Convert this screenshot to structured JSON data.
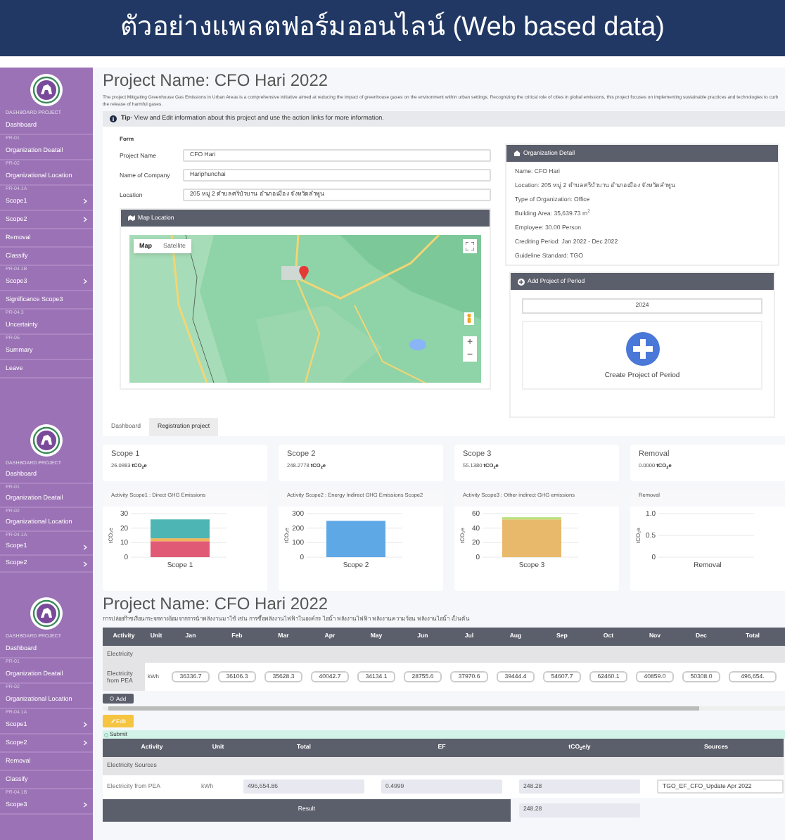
{
  "slide_title": "ตัวอย่างแพลตฟอร์มออนไลน์ (Web based data)",
  "project_panel": {
    "sidebar": {
      "subtitle": "DASHBOARD PROJECT",
      "items": [
        {
          "kind": "link",
          "label": "Dashboard",
          "submenu": false
        },
        {
          "kind": "section",
          "label": "PR-01"
        },
        {
          "kind": "link",
          "label": "Organization Deatail",
          "submenu": false
        },
        {
          "kind": "section",
          "label": "PR-02"
        },
        {
          "kind": "link",
          "label": "Organizational Location",
          "submenu": false
        },
        {
          "kind": "section",
          "label": "PR-04.1A"
        },
        {
          "kind": "link",
          "label": "Scope1",
          "submenu": true
        },
        {
          "kind": "link",
          "label": "Scope2",
          "submenu": true
        },
        {
          "kind": "link",
          "label": "Removal",
          "submenu": false
        },
        {
          "kind": "link",
          "label": "Classify",
          "submenu": false
        },
        {
          "kind": "section",
          "label": "PR-04.1B"
        },
        {
          "kind": "link",
          "label": "Scope3",
          "submenu": true
        },
        {
          "kind": "link",
          "label": "Significance Scope3",
          "submenu": false
        },
        {
          "kind": "section",
          "label": "PR-04.3"
        },
        {
          "kind": "link",
          "label": "Uncertainty",
          "submenu": false
        },
        {
          "kind": "section",
          "label": "PR-05"
        },
        {
          "kind": "link",
          "label": "Summary",
          "submenu": false
        },
        {
          "kind": "link",
          "label": "Leave",
          "submenu": false
        }
      ]
    },
    "title": "Project Name: CFO Hari 2022",
    "description": "The project Mitigating Greenhouse Gas Emissions in Urban Areas is a comprehensive initiative aimed at reducing the impact of greenhouse gases on the environment within urban settings. Recognizing the critical role of cities in global emissions, this project focuses on implementing sustainable practices and technologies to curb the release of harmful gases.",
    "tip": "**Tip**- View and Edit information about this project and use the action links for more information.",
    "form": {
      "heading": "Form",
      "fields": [
        {
          "label": "Project Name",
          "value": "CFO Hari"
        },
        {
          "label": "Name of Company",
          "value": "Hariphunchai"
        },
        {
          "label": "Location",
          "value": "205 หมู่ 2 ตำบลศรีบัวบาน อำเภอเมือง จังหวัดลำพูน"
        }
      ]
    },
    "map": {
      "header": "Map Location",
      "map_types": [
        {
          "label": "Map",
          "selected": true
        },
        {
          "label": "Satellite",
          "selected": false
        }
      ],
      "zoom_in": "+",
      "zoom_out": "−"
    },
    "organization_detail": {
      "header": "Organization Detail",
      "lines": [
        "Name: CFO Hari",
        "Location: 205 หมู่ 2 ตำบลศรีบัวบาน อำเภอเมือง จังหวัดลำพูน",
        "Type of Organization: Office",
        "Building Area: 35,639.73 m$^{2}$",
        "Employee: 30.00 Person",
        "Crediting Period: Jan 2022 - Dec 2022",
        "Guideline Standard: TGO"
      ]
    },
    "add_period": {
      "header": "Add Project of Period",
      "year": "2024",
      "create_label": "Create Project of Period"
    },
    "tabs": [
      {
        "label": "Dashboard",
        "selected": true
      },
      {
        "label": "Registration project",
        "selected": false
      }
    ]
  },
  "dashboard_panel": {
    "sidebar": {
      "subtitle": "DASHBOARD PROJECT",
      "items": [
        {
          "kind": "link",
          "label": "Dashboard",
          "submenu": false
        },
        {
          "kind": "section",
          "label": "PR-01"
        },
        {
          "kind": "link",
          "label": "Organization Deatail",
          "submenu": false
        },
        {
          "kind": "section",
          "label": "PR-02"
        },
        {
          "kind": "link",
          "label": "Organizational Location",
          "submenu": false
        },
        {
          "kind": "section",
          "label": "PR-04.1A"
        },
        {
          "kind": "link",
          "label": "Scope1",
          "submenu": true
        },
        {
          "kind": "link",
          "label": "Scope2",
          "submenu": true
        }
      ]
    },
    "stats": [
      {
        "label": "Scope 1",
        "value": "26.0983",
        "unit": "tCO$_{2}$e"
      },
      {
        "label": "Scope 2",
        "value": "248.2778",
        "unit": "tCO$_{2}$e"
      },
      {
        "label": "Scope 3",
        "value": "55.1380",
        "unit": "tCO$_{2}$e"
      },
      {
        "label": "Removal",
        "value": "0.0000",
        "unit": "tCO$_{2}$e"
      }
    ],
    "charts": [
      {
        "title": "Activity Scope1 : Direct GHG Emissions",
        "chart_data": {
          "type": "bar",
          "stacked": true,
          "ylabel": "tCO₂e",
          "categories": [
            "Scope 1"
          ],
          "ylim": [
            0,
            30
          ],
          "yticks": [
            0,
            10,
            20,
            30
          ],
          "series": [
            {
              "color": "#e05a75",
              "values": [
                11
              ]
            },
            {
              "color": "#f0b55a",
              "values": [
                2
              ]
            },
            {
              "color": "#4db6b4",
              "values": [
                13
              ]
            }
          ]
        }
      },
      {
        "title": "Activity Scope2 : Energy Indirect GHG Emissions Scope2",
        "chart_data": {
          "type": "bar",
          "stacked": true,
          "ylabel": "tCO₂e",
          "categories": [
            "Scope 2"
          ],
          "ylim": [
            0,
            300
          ],
          "yticks": [
            0,
            100,
            200,
            300
          ],
          "series": [
            {
              "color": "#5ea8e6",
              "values": [
                250
              ]
            }
          ]
        }
      },
      {
        "title": "Activity Scope3 : Other indirect GHG emissions",
        "chart_data": {
          "type": "bar",
          "stacked": true,
          "ylabel": "tCO₂e",
          "categories": [
            "Scope 3"
          ],
          "ylim": [
            0,
            60
          ],
          "yticks": [
            0,
            20,
            40,
            60
          ],
          "series": [
            {
              "color": "#e8b96a",
              "values": [
                52
              ]
            },
            {
              "color": "#b8e07a",
              "values": [
                3
              ]
            }
          ]
        }
      },
      {
        "title": "Removal",
        "chart_data": {
          "type": "bar",
          "stacked": true,
          "ylabel": "tCO₂e",
          "categories": [
            "Removal"
          ],
          "ylim": [
            0,
            1
          ],
          "yticks": [
            0,
            {
              "value": 0.5,
              "label": "0.5"
            },
            {
              "value": 1,
              "label": "1.0"
            }
          ],
          "series": [
            {
              "color": "#5ea8e6",
              "values": [
                0
              ]
            }
          ]
        }
      }
    ]
  },
  "activity_panel": {
    "sidebar": {
      "subtitle": "DASHBOARD PROJECT",
      "items": [
        {
          "kind": "link",
          "label": "Dashboard",
          "submenu": false
        },
        {
          "kind": "section",
          "label": "PR-01"
        },
        {
          "kind": "link",
          "label": "Organization Deatail",
          "submenu": false
        },
        {
          "kind": "section",
          "label": "PR-02"
        },
        {
          "kind": "link",
          "label": "Organizational Location",
          "submenu": false
        },
        {
          "kind": "section",
          "label": "PR-04.1A"
        },
        {
          "kind": "link",
          "label": "Scope1",
          "submenu": true
        },
        {
          "kind": "link",
          "label": "Scope2",
          "submenu": true
        },
        {
          "kind": "link",
          "label": "Removal",
          "submenu": false
        },
        {
          "kind": "link",
          "label": "Classify",
          "submenu": false
        },
        {
          "kind": "section",
          "label": "PR-04.1B"
        },
        {
          "kind": "link",
          "label": "Scope3",
          "submenu": true
        }
      ]
    },
    "title": "Project Name: CFO Hari 2022",
    "description": "การปล่อยก๊าซเรือนกระจกทางอ้อมจากการนำพลังงานมาใช้ เช่น การซื้อพลังงานไฟฟ้าในองค์กร ไอน้ำ พลังงานไฟฟ้า พลังงานความร้อน พลังงานไอน้ำ เป็นต้น",
    "monthly_table": {
      "columns": [
        "Activity",
        "Unit",
        "Jan",
        "Feb",
        "Mar",
        "Apr",
        "May",
        "Jun",
        "Jul",
        "Aug",
        "Sep",
        "Oct",
        "Nov",
        "Dec",
        "Total"
      ],
      "group": "Electricity",
      "rows": [
        {
          "activity": "Electricity from PEA",
          "unit": "kWh",
          "values": [
            "36336.7",
            "36106.3",
            "35628.3",
            "40042.7",
            "34134.1",
            "28755.6",
            "37970.6",
            "39444.4",
            "54607.7",
            "62460.1",
            "40859.0",
            "50308.0",
            "496,654."
          ]
        }
      ]
    },
    "add_button": "Add",
    "edit_button": "Edit",
    "submit_label": "Submit",
    "summary_table": {
      "columns": [
        "Activity",
        "Unit",
        "Total",
        "EF",
        "tCO$_{2}$e/y",
        "Sources"
      ],
      "group": "Electricity Sources",
      "rows": [
        {
          "activity": "Electricity from PEA",
          "unit": "kWh",
          "total": "496,654.86",
          "ef": "0.4999",
          "tco2e": "248.28",
          "source": "TGO_EF_CFO_Update Apr 2022"
        }
      ],
      "result_label": "Result",
      "result_value": "248.28"
    }
  }
}
